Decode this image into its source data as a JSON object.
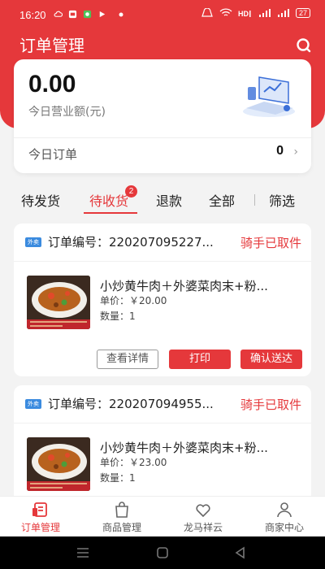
{
  "status_bar": {
    "time": "16:20",
    "battery": "27"
  },
  "header": {
    "title": "订单管理"
  },
  "summary": {
    "amount": "0.00",
    "amount_label": "今日营业额(元)",
    "today_orders_label": "今日订单",
    "today_orders_count": "0"
  },
  "tabs": [
    {
      "label": "待发货"
    },
    {
      "label": "待收货",
      "badge": "2"
    },
    {
      "label": "退款"
    },
    {
      "label": "全部"
    },
    {
      "label": "筛选"
    }
  ],
  "orders": [
    {
      "tag": "外卖",
      "order_no": "订单编号：220207095227...",
      "status": "骑手已取件",
      "product_name": "小炒黄牛肉＋外婆菜肉末+粉...",
      "price": "单价：￥20.00",
      "quantity": "数量：1",
      "buttons": {
        "details": "查看详情",
        "print": "打印",
        "confirm": "确认送达"
      }
    },
    {
      "tag": "外卖",
      "order_no": "订单编号：220207094955...",
      "status": "骑手已取件",
      "product_name": "小炒黄牛肉＋外婆菜肉末+粉...",
      "price": "单价：￥23.00",
      "quantity": "数量：1"
    }
  ],
  "bottom_nav": [
    {
      "label": "订单管理",
      "icon": "order-icon",
      "active": true
    },
    {
      "label": "商品管理",
      "icon": "bag-icon"
    },
    {
      "label": "龙马祥云",
      "icon": "heart-icon"
    },
    {
      "label": "商家中心",
      "icon": "user-icon"
    }
  ],
  "colors": {
    "accent": "#e5383b",
    "tag_blue": "#3b8bdf"
  }
}
